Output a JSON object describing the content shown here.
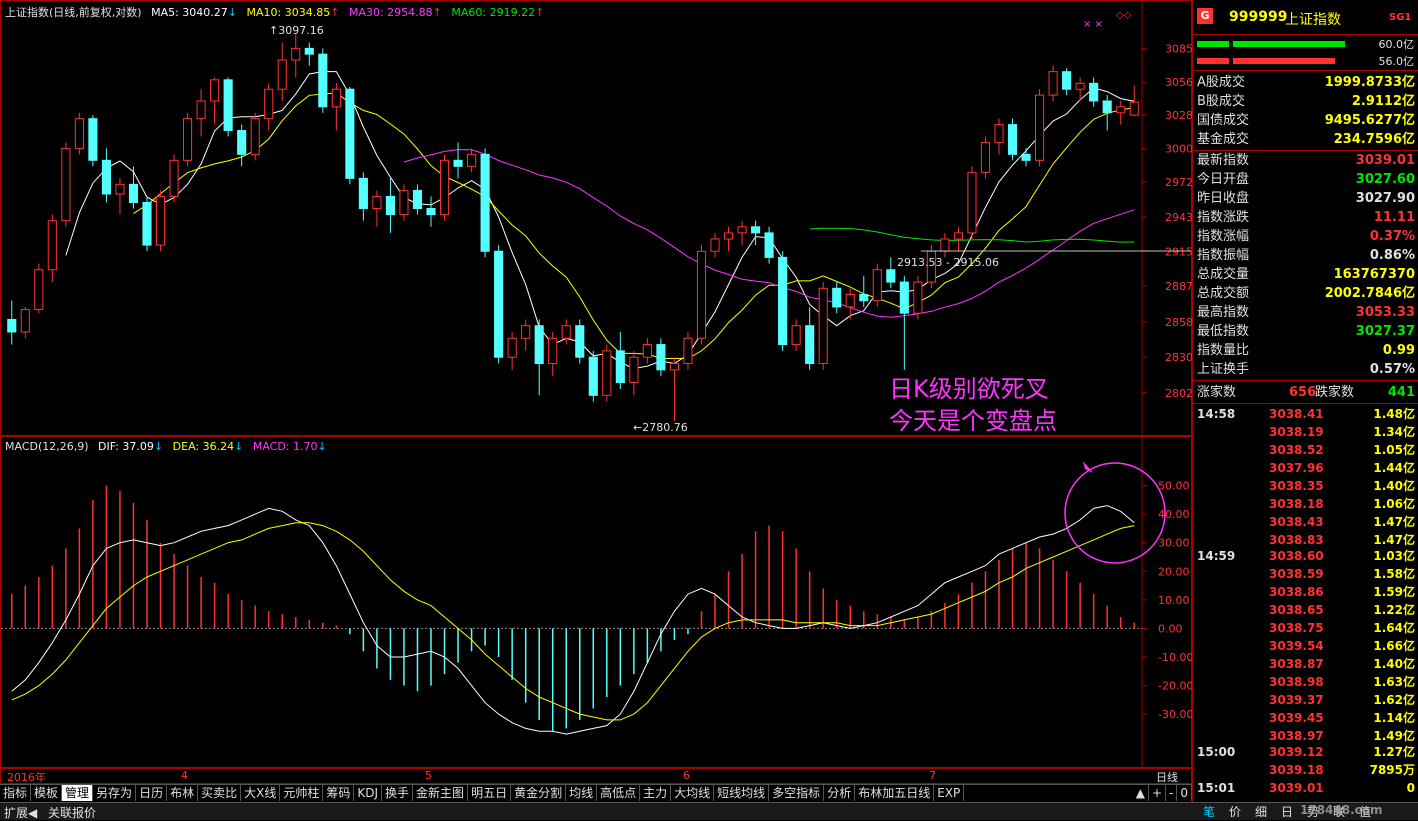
{
  "kline": {
    "title": "上证指数(日线,前复权,对数)",
    "ma5": "MA5: 3040.27",
    "ma10": "MA10: 3034.85",
    "ma30": "MA30: 2954.88",
    "ma60": "MA60: 2919.22",
    "y_ticks": [
      "3085",
      "3056",
      "3028",
      "3000",
      "2972",
      "2943",
      "2915",
      "2887",
      "2858",
      "2830",
      "2802"
    ],
    "high_label": "3097.16",
    "low_label": "2780.76",
    "range_label": "2913.53 - 2915.06",
    "annotation_line1": "日K级别欲死叉",
    "annotation_line2": "今天是个变盘点"
  },
  "macd": {
    "title": "MACD(12,26,9)",
    "dif": "DIF: 37.09",
    "dea": "DEA: 36.24",
    "macd": "MACD: 1.70",
    "y_ticks": [
      "50.00",
      "40.00",
      "30.00",
      "20.00",
      "10.00",
      "0.00",
      "-10.00",
      "-20.00",
      "-30.00"
    ]
  },
  "xaxis": {
    "labels": [
      "2016年",
      "4",
      "5",
      "6",
      "7"
    ],
    "period": "日线"
  },
  "tabs": [
    "指标",
    "模板",
    "管理",
    "另存为",
    "日历",
    "布林",
    "买卖比",
    "大X线",
    "元帅柱",
    "筹码",
    "KDJ",
    "换手",
    "金新主图",
    "明五日",
    "黄金分割",
    "均线",
    "高低点",
    "主力",
    "大均线",
    "短线均线",
    "多空指标",
    "分析",
    "布林加五日线",
    "EXP"
  ],
  "tab_controls": [
    "▲",
    "+",
    "-",
    "0"
  ],
  "status": {
    "left": [
      "扩展◀",
      "关联报价"
    ],
    "right": [
      "笔",
      "价",
      "细",
      "日",
      "势",
      "联",
      "值"
    ],
    "watermark": "178448.com"
  },
  "quote": {
    "badge": "G",
    "code": "999999",
    "name": "上证指数",
    "tag": "SG1",
    "bar1_val": "60.0亿",
    "bar2_val": "56.0亿",
    "rows": [
      {
        "label": "A股成交",
        "value": "1999.8733亿",
        "color": "#ffff00"
      },
      {
        "label": "B股成交",
        "value": "2.9112亿",
        "color": "#ffff00"
      },
      {
        "label": "国债成交",
        "value": "9495.6277亿",
        "color": "#ffff00"
      },
      {
        "label": "基金成交",
        "value": "234.7596亿",
        "color": "#ffff00"
      },
      {
        "label": "最新指数",
        "value": "3039.01",
        "color": "#ff3232"
      },
      {
        "label": "今日开盘",
        "value": "3027.60",
        "color": "#00e600"
      },
      {
        "label": "昨日收盘",
        "value": "3027.90",
        "color": "#e0e0e0"
      },
      {
        "label": "指数涨跌",
        "value": "11.11",
        "color": "#ff3232"
      },
      {
        "label": "指数涨幅",
        "value": "0.37%",
        "color": "#ff3232"
      },
      {
        "label": "指数振幅",
        "value": "0.86%",
        "color": "#e0e0e0"
      },
      {
        "label": "总成交量",
        "value": "163767370",
        "color": "#ffff00"
      },
      {
        "label": "总成交额",
        "value": "2002.7846亿",
        "color": "#ffff00"
      },
      {
        "label": "最高指数",
        "value": "3053.33",
        "color": "#ff3232"
      },
      {
        "label": "最低指数",
        "value": "3027.37",
        "color": "#00e600"
      },
      {
        "label": "指数量比",
        "value": "0.99",
        "color": "#ffff00"
      },
      {
        "label": "上证换手",
        "value": "0.57%",
        "color": "#e0e0e0"
      }
    ],
    "breadth_up_label": "涨家数",
    "breadth_up": "656",
    "breadth_down_label": "跌家数",
    "breadth_down": "441",
    "ticks": [
      {
        "t": "14:58",
        "p": "3038.41",
        "q": "1.48亿"
      },
      {
        "t": "",
        "p": "3038.19",
        "q": "1.34亿"
      },
      {
        "t": "",
        "p": "3038.52",
        "q": "1.05亿"
      },
      {
        "t": "",
        "p": "3037.96",
        "q": "1.44亿"
      },
      {
        "t": "",
        "p": "3038.35",
        "q": "1.40亿"
      },
      {
        "t": "",
        "p": "3038.18",
        "q": "1.06亿"
      },
      {
        "t": "",
        "p": "3038.43",
        "q": "1.47亿"
      },
      {
        "t": "",
        "p": "3038.83",
        "q": "1.47亿"
      },
      {
        "t": "14:59",
        "p": "3038.60",
        "q": "1.03亿"
      },
      {
        "t": "",
        "p": "3038.59",
        "q": "1.58亿"
      },
      {
        "t": "",
        "p": "3038.86",
        "q": "1.59亿"
      },
      {
        "t": "",
        "p": "3038.65",
        "q": "1.22亿"
      },
      {
        "t": "",
        "p": "3038.75",
        "q": "1.64亿"
      },
      {
        "t": "",
        "p": "3039.54",
        "q": "1.66亿"
      },
      {
        "t": "",
        "p": "3038.87",
        "q": "1.40亿"
      },
      {
        "t": "",
        "p": "3038.98",
        "q": "1.63亿"
      },
      {
        "t": "",
        "p": "3039.37",
        "q": "1.62亿"
      },
      {
        "t": "",
        "p": "3039.45",
        "q": "1.14亿"
      },
      {
        "t": "",
        "p": "3038.97",
        "q": "1.49亿"
      },
      {
        "t": "15:00",
        "p": "3039.12",
        "q": "1.27亿"
      },
      {
        "t": "",
        "p": "3039.18",
        "q": "7895万"
      },
      {
        "t": "15:01",
        "p": "3039.01",
        "q": "0"
      }
    ]
  },
  "chart_data": {
    "type": "candlestick",
    "candles": [
      [
        2860,
        2875,
        2840,
        2850
      ],
      [
        2850,
        2870,
        2845,
        2868
      ],
      [
        2868,
        2905,
        2865,
        2900
      ],
      [
        2900,
        2945,
        2890,
        2940
      ],
      [
        2940,
        3005,
        2935,
        3000
      ],
      [
        3000,
        3030,
        2995,
        3025
      ],
      [
        3025,
        3028,
        2985,
        2990
      ],
      [
        2990,
        3000,
        2955,
        2962
      ],
      [
        2962,
        2975,
        2945,
        2970
      ],
      [
        2970,
        2985,
        2950,
        2955
      ],
      [
        2955,
        2960,
        2915,
        2920
      ],
      [
        2920,
        2965,
        2915,
        2960
      ],
      [
        2960,
        2995,
        2955,
        2990
      ],
      [
        2990,
        3030,
        2985,
        3025
      ],
      [
        3025,
        3050,
        3010,
        3040
      ],
      [
        3040,
        3060,
        3020,
        3058
      ],
      [
        3058,
        3060,
        3010,
        3015
      ],
      [
        3015,
        3020,
        2985,
        2995
      ],
      [
        2995,
        3030,
        2990,
        3025
      ],
      [
        3025,
        3055,
        3015,
        3050
      ],
      [
        3050,
        3090,
        3040,
        3075
      ],
      [
        3075,
        3097,
        3060,
        3085
      ],
      [
        3085,
        3090,
        3070,
        3080
      ],
      [
        3080,
        3085,
        3030,
        3035
      ],
      [
        3035,
        3055,
        3015,
        3050
      ],
      [
        3050,
        3052,
        2970,
        2975
      ],
      [
        2975,
        2980,
        2940,
        2950
      ],
      [
        2950,
        2965,
        2935,
        2960
      ],
      [
        2960,
        2975,
        2930,
        2945
      ],
      [
        2945,
        2970,
        2940,
        2965
      ],
      [
        2965,
        2970,
        2945,
        2950
      ],
      [
        2950,
        2960,
        2935,
        2945
      ],
      [
        2945,
        2995,
        2940,
        2990
      ],
      [
        2990,
        3005,
        2975,
        2985
      ],
      [
        2985,
        3000,
        2980,
        2995
      ],
      [
        2995,
        3000,
        2910,
        2915
      ],
      [
        2915,
        2920,
        2825,
        2830
      ],
      [
        2830,
        2850,
        2820,
        2845
      ],
      [
        2845,
        2860,
        2835,
        2855
      ],
      [
        2855,
        2860,
        2800,
        2825
      ],
      [
        2825,
        2850,
        2815,
        2845
      ],
      [
        2845,
        2860,
        2840,
        2855
      ],
      [
        2855,
        2860,
        2825,
        2830
      ],
      [
        2830,
        2835,
        2795,
        2800
      ],
      [
        2800,
        2840,
        2795,
        2835
      ],
      [
        2835,
        2850,
        2805,
        2810
      ],
      [
        2810,
        2835,
        2800,
        2830
      ],
      [
        2830,
        2845,
        2825,
        2840
      ],
      [
        2840,
        2845,
        2815,
        2820
      ],
      [
        2820,
        2830,
        2780,
        2825
      ],
      [
        2825,
        2850,
        2820,
        2845
      ],
      [
        2845,
        2920,
        2840,
        2915
      ],
      [
        2915,
        2930,
        2910,
        2925
      ],
      [
        2925,
        2935,
        2915,
        2930
      ],
      [
        2930,
        2940,
        2920,
        2935
      ],
      [
        2935,
        2940,
        2920,
        2930
      ],
      [
        2930,
        2935,
        2905,
        2910
      ],
      [
        2910,
        2915,
        2835,
        2840
      ],
      [
        2840,
        2860,
        2835,
        2855
      ],
      [
        2855,
        2870,
        2820,
        2825
      ],
      [
        2825,
        2890,
        2820,
        2885
      ],
      [
        2885,
        2890,
        2865,
        2870
      ],
      [
        2870,
        2885,
        2860,
        2880
      ],
      [
        2880,
        2895,
        2870,
        2875
      ],
      [
        2875,
        2905,
        2870,
        2900
      ],
      [
        2900,
        2910,
        2885,
        2890
      ],
      [
        2890,
        2895,
        2820,
        2865
      ],
      [
        2865,
        2895,
        2860,
        2890
      ],
      [
        2890,
        2920,
        2885,
        2915
      ],
      [
        2915,
        2930,
        2910,
        2925
      ],
      [
        2925,
        2935,
        2915,
        2930
      ],
      [
        2930,
        2985,
        2925,
        2980
      ],
      [
        2980,
        3010,
        2975,
        3005
      ],
      [
        3005,
        3025,
        2995,
        3020
      ],
      [
        3020,
        3025,
        2990,
        2995
      ],
      [
        2995,
        3000,
        2985,
        2990
      ],
      [
        2990,
        3050,
        2985,
        3045
      ],
      [
        3045,
        3070,
        3040,
        3065
      ],
      [
        3065,
        3068,
        3045,
        3050
      ],
      [
        3050,
        3060,
        3040,
        3055
      ],
      [
        3055,
        3060,
        3035,
        3040
      ],
      [
        3040,
        3045,
        3015,
        3030
      ],
      [
        3030,
        3040,
        3020,
        3035
      ],
      [
        3028,
        3053,
        3027,
        3039
      ]
    ],
    "y_scale": "log",
    "y_range": [
      2780,
      3100
    ],
    "macd_bars": [
      12,
      15,
      18,
      22,
      28,
      35,
      45,
      50,
      48,
      44,
      38,
      30,
      26,
      22,
      18,
      16,
      12,
      10,
      8,
      6,
      5,
      4,
      3,
      2,
      1,
      -2,
      -8,
      -14,
      -18,
      -20,
      -22,
      -20,
      -16,
      -12,
      -8,
      -6,
      -10,
      -18,
      -26,
      -32,
      -36,
      -35,
      -32,
      -28,
      -24,
      -20,
      -16,
      -12,
      -8,
      -4,
      -2,
      6,
      12,
      20,
      26,
      34,
      36,
      34,
      28,
      20,
      14,
      10,
      8,
      6,
      5,
      4,
      3,
      4,
      6,
      9,
      12,
      16,
      20,
      24,
      28,
      30,
      28,
      24,
      20,
      16,
      12,
      8,
      4,
      2
    ],
    "macd_dif": [
      -22,
      -18,
      -12,
      -5,
      3,
      12,
      22,
      28,
      30,
      31,
      30,
      29,
      30,
      32,
      34,
      35,
      36,
      38,
      40,
      42,
      41,
      38,
      36,
      30,
      22,
      12,
      2,
      -6,
      -10,
      -10,
      -9,
      -8,
      -10,
      -14,
      -20,
      -26,
      -30,
      -33,
      -35,
      -36,
      -36,
      -37,
      -36,
      -35,
      -34,
      -30,
      -22,
      -12,
      -2,
      6,
      12,
      14,
      12,
      8,
      4,
      2,
      1,
      0,
      0,
      1,
      2,
      1,
      0,
      1,
      2,
      4,
      6,
      8,
      12,
      16,
      18,
      20,
      22,
      26,
      28,
      30,
      32,
      33,
      35,
      38,
      42,
      43,
      41,
      37
    ],
    "macd_dea": [
      -25,
      -23,
      -20,
      -16,
      -11,
      -5,
      1,
      7,
      11,
      15,
      18,
      20,
      22,
      24,
      26,
      28,
      30,
      31,
      33,
      35,
      36,
      37,
      37,
      36,
      34,
      31,
      27,
      22,
      17,
      13,
      10,
      8,
      4,
      0,
      -4,
      -9,
      -13,
      -17,
      -21,
      -24,
      -26,
      -28,
      -30,
      -31,
      -32,
      -32,
      -30,
      -26,
      -20,
      -14,
      -8,
      -3,
      0,
      2,
      3,
      3,
      3,
      3,
      2,
      2,
      2,
      2,
      1,
      1,
      1,
      2,
      3,
      4,
      5,
      7,
      9,
      11,
      13,
      16,
      18,
      21,
      23,
      25,
      27,
      29,
      31,
      33,
      35,
      36
    ]
  }
}
